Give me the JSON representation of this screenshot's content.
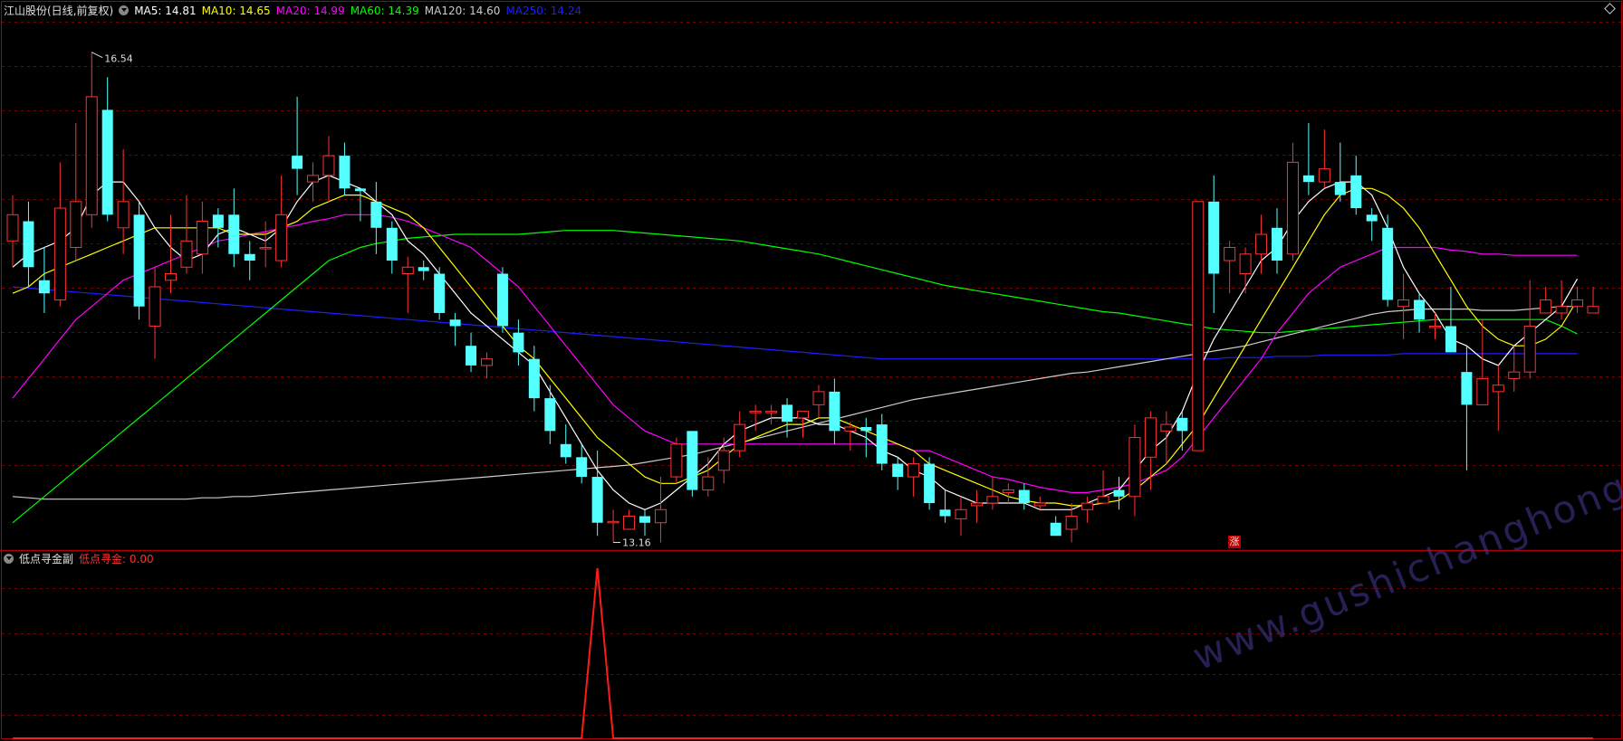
{
  "header": {
    "title": "江山股份(日线,前复权)",
    "ma": [
      {
        "label": "MA5: 14.81",
        "color": "#ffffff"
      },
      {
        "label": "MA10: 14.65",
        "color": "#ffff00"
      },
      {
        "label": "MA20: 14.99",
        "color": "#ff00ff"
      },
      {
        "label": "MA60: 14.39",
        "color": "#00ff00"
      },
      {
        "label": "MA120: 14.60",
        "color": "#cccccc"
      },
      {
        "label": "MA250: 14.24",
        "color": "#1e1eff"
      }
    ]
  },
  "sub_header": {
    "title": "低点寻金副",
    "indicator": "低点寻金: 0.00",
    "indicator_color": "#ff3030"
  },
  "annotations": {
    "high": "16.54",
    "low": "13.16",
    "signal_badge": "涨"
  },
  "watermark": "www.gushichanghong.com",
  "colors": {
    "up": "#ff3232",
    "down": "#54ffff",
    "grid": "#7a0000",
    "frame": "#b00000"
  },
  "chart_data": [
    {
      "type": "candlestick",
      "title": "江山股份(日线,前复权)",
      "ylim": [
        12.9,
        16.8
      ],
      "candles": [
        [
          15.1,
          15.3,
          15.45,
          14.9
        ],
        [
          15.25,
          14.9,
          15.4,
          14.75
        ],
        [
          14.8,
          14.7,
          15.05,
          14.55
        ],
        [
          14.65,
          15.35,
          15.7,
          14.6
        ],
        [
          15.05,
          15.4,
          16.0,
          14.95
        ],
        [
          15.3,
          16.2,
          16.54,
          15.2
        ],
        [
          16.1,
          15.3,
          16.35,
          15.25
        ],
        [
          15.2,
          15.4,
          15.8,
          15.0
        ],
        [
          15.3,
          14.6,
          15.4,
          14.5
        ],
        [
          14.45,
          14.75,
          14.9,
          14.2
        ],
        [
          14.8,
          14.85,
          15.3,
          14.7
        ],
        [
          14.9,
          15.1,
          15.45,
          14.85
        ],
        [
          15.0,
          15.25,
          15.4,
          14.85
        ],
        [
          15.3,
          15.2,
          15.35,
          15.05
        ],
        [
          15.3,
          15.0,
          15.5,
          14.9
        ],
        [
          15.0,
          14.95,
          15.1,
          14.8
        ],
        [
          15.05,
          15.05,
          15.25,
          14.9
        ],
        [
          14.95,
          15.3,
          15.6,
          14.9
        ],
        [
          15.75,
          15.65,
          16.2,
          15.45
        ],
        [
          15.55,
          15.6,
          15.7,
          15.4
        ],
        [
          15.6,
          15.75,
          15.9,
          15.4
        ],
        [
          15.75,
          15.5,
          15.85,
          15.45
        ],
        [
          15.5,
          15.48,
          15.5,
          15.25
        ],
        [
          15.4,
          15.2,
          15.55,
          15.0
        ],
        [
          15.2,
          14.95,
          15.25,
          14.85
        ],
        [
          14.85,
          14.9,
          14.98,
          14.55
        ],
        [
          14.9,
          14.87,
          14.95,
          14.8
        ],
        [
          14.85,
          14.55,
          14.9,
          14.5
        ],
        [
          14.5,
          14.45,
          14.55,
          14.3
        ],
        [
          14.3,
          14.15,
          14.4,
          14.1
        ],
        [
          14.15,
          14.2,
          14.25,
          14.05
        ],
        [
          14.85,
          14.45,
          14.9,
          14.4
        ],
        [
          14.4,
          14.25,
          14.5,
          14.15
        ],
        [
          14.2,
          13.9,
          14.3,
          13.8
        ],
        [
          13.9,
          13.65,
          14.0,
          13.55
        ],
        [
          13.55,
          13.45,
          13.7,
          13.4
        ],
        [
          13.45,
          13.3,
          13.55,
          13.25
        ],
        [
          13.3,
          12.95,
          13.5,
          12.85
        ],
        [
          12.95,
          12.96,
          13.05,
          12.8
        ],
        [
          12.9,
          13.0,
          13.05,
          12.9
        ],
        [
          13.0,
          12.95,
          13.05,
          12.85
        ],
        [
          12.95,
          13.05,
          13.3,
          12.8
        ],
        [
          13.3,
          13.55,
          13.6,
          13.25
        ],
        [
          13.65,
          13.2,
          13.65,
          13.15
        ],
        [
          13.2,
          13.3,
          13.45,
          13.15
        ],
        [
          13.35,
          13.5,
          13.6,
          13.25
        ],
        [
          13.5,
          13.7,
          13.8,
          13.45
        ],
        [
          13.8,
          13.8,
          13.85,
          13.65
        ],
        [
          13.8,
          13.8,
          13.85,
          13.7
        ],
        [
          13.85,
          13.72,
          13.9,
          13.6
        ],
        [
          13.75,
          13.8,
          13.8,
          13.6
        ],
        [
          13.85,
          13.95,
          14.0,
          13.75
        ],
        [
          13.95,
          13.65,
          14.05,
          13.55
        ],
        [
          13.65,
          13.68,
          13.72,
          13.5
        ],
        [
          13.68,
          13.65,
          13.75,
          13.45
        ],
        [
          13.7,
          13.4,
          13.78,
          13.35
        ],
        [
          13.4,
          13.3,
          13.45,
          13.2
        ],
        [
          13.3,
          13.4,
          13.45,
          13.15
        ],
        [
          13.4,
          13.1,
          13.45,
          13.05
        ],
        [
          13.05,
          13.0,
          13.2,
          12.95
        ],
        [
          12.98,
          13.05,
          13.15,
          12.85
        ],
        [
          13.08,
          13.1,
          13.2,
          12.95
        ],
        [
          13.1,
          13.15,
          13.3,
          13.05
        ],
        [
          13.18,
          13.2,
          13.25,
          13.1
        ],
        [
          13.2,
          13.1,
          13.25,
          13.05
        ],
        [
          13.08,
          13.1,
          13.15,
          13.05
        ],
        [
          12.95,
          12.85,
          13.0,
          12.85
        ],
        [
          12.9,
          13.0,
          13.1,
          12.8
        ],
        [
          13.05,
          13.1,
          13.15,
          12.95
        ],
        [
          13.1,
          13.15,
          13.35,
          13.1
        ],
        [
          13.2,
          13.15,
          13.3,
          13.05
        ],
        [
          13.15,
          13.6,
          13.7,
          13.0
        ],
        [
          13.45,
          13.75,
          13.8,
          13.2
        ],
        [
          13.65,
          13.7,
          13.8,
          13.4
        ],
        [
          13.75,
          13.65,
          13.8,
          13.5
        ],
        [
          13.5,
          15.4,
          15.4,
          13.5
        ],
        [
          15.4,
          14.85,
          15.6,
          14.55
        ],
        [
          14.95,
          15.05,
          15.1,
          14.7
        ],
        [
          14.85,
          15.0,
          15.05,
          14.7
        ],
        [
          15.0,
          15.15,
          15.3,
          14.85
        ],
        [
          15.2,
          14.95,
          15.35,
          14.85
        ],
        [
          15.0,
          15.7,
          15.85,
          14.95
        ],
        [
          15.6,
          15.55,
          16.0,
          15.45
        ],
        [
          15.55,
          15.65,
          15.95,
          15.5
        ],
        [
          15.55,
          15.45,
          15.85,
          15.4
        ],
        [
          15.6,
          15.35,
          15.75,
          15.3
        ],
        [
          15.3,
          15.25,
          15.35,
          15.1
        ],
        [
          15.2,
          14.65,
          15.3,
          14.6
        ],
        [
          14.6,
          14.65,
          14.85,
          14.35
        ],
        [
          14.65,
          14.5,
          14.7,
          14.4
        ],
        [
          14.45,
          14.45,
          14.55,
          14.35
        ],
        [
          14.45,
          14.25,
          14.75,
          14.25
        ],
        [
          14.1,
          13.85,
          14.3,
          13.35
        ],
        [
          13.85,
          14.05,
          14.5,
          13.85
        ],
        [
          13.95,
          14.0,
          14.15,
          13.65
        ],
        [
          14.05,
          14.1,
          14.3,
          13.95
        ],
        [
          14.1,
          14.45,
          14.8,
          14.05
        ],
        [
          14.55,
          14.65,
          14.75,
          14.55
        ],
        [
          14.55,
          14.6,
          14.8,
          14.5
        ],
        [
          14.6,
          14.65,
          14.75,
          14.55
        ],
        [
          14.55,
          14.6,
          14.75,
          14.55
        ]
      ],
      "ma5": [
        14.9,
        15.0,
        15.05,
        15.1,
        15.2,
        15.45,
        15.55,
        15.55,
        15.4,
        15.2,
        15.05,
        14.95,
        15.0,
        15.15,
        15.2,
        15.15,
        15.1,
        15.2,
        15.4,
        15.55,
        15.6,
        15.55,
        15.5,
        15.4,
        15.3,
        15.1,
        15.0,
        14.85,
        14.7,
        14.55,
        14.45,
        14.35,
        14.25,
        14.15,
        13.95,
        13.75,
        13.55,
        13.35,
        13.2,
        13.1,
        13.05,
        13.1,
        13.2,
        13.3,
        13.4,
        13.55,
        13.65,
        13.7,
        13.75,
        13.75,
        13.75,
        13.7,
        13.7,
        13.65,
        13.6,
        13.5,
        13.45,
        13.35,
        13.3,
        13.2,
        13.15,
        13.1,
        13.1,
        13.1,
        13.1,
        13.05,
        13.05,
        13.05,
        13.1,
        13.15,
        13.2,
        13.35,
        13.5,
        13.6,
        13.8,
        14.1,
        14.35,
        14.55,
        14.75,
        14.95,
        15.05,
        15.25,
        15.4,
        15.5,
        15.55,
        15.55,
        15.45,
        15.2,
        14.9,
        14.7,
        14.55,
        14.35,
        14.3,
        14.2,
        14.15,
        14.3,
        14.4,
        14.5,
        14.6,
        14.81
      ],
      "ma10": [
        14.7,
        14.75,
        14.85,
        14.9,
        14.95,
        15.0,
        15.05,
        15.1,
        15.15,
        15.2,
        15.2,
        15.2,
        15.2,
        15.2,
        15.15,
        15.15,
        15.15,
        15.2,
        15.25,
        15.35,
        15.4,
        15.45,
        15.45,
        15.4,
        15.35,
        15.3,
        15.2,
        15.05,
        14.9,
        14.75,
        14.6,
        14.45,
        14.3,
        14.2,
        14.05,
        13.9,
        13.75,
        13.6,
        13.5,
        13.4,
        13.3,
        13.25,
        13.25,
        13.3,
        13.35,
        13.45,
        13.55,
        13.6,
        13.65,
        13.7,
        13.7,
        13.75,
        13.75,
        13.7,
        13.65,
        13.6,
        13.55,
        13.5,
        13.4,
        13.35,
        13.3,
        13.25,
        13.2,
        13.15,
        13.12,
        13.1,
        13.1,
        13.08,
        13.08,
        13.1,
        13.12,
        13.2,
        13.3,
        13.4,
        13.55,
        13.7,
        13.9,
        14.1,
        14.3,
        14.5,
        14.7,
        14.9,
        15.1,
        15.3,
        15.45,
        15.5,
        15.5,
        15.45,
        15.35,
        15.2,
        15.0,
        14.8,
        14.6,
        14.45,
        14.35,
        14.3,
        14.3,
        14.35,
        14.45,
        14.65
      ],
      "ma20": [
        13.9,
        14.05,
        14.2,
        14.35,
        14.5,
        14.6,
        14.7,
        14.8,
        14.85,
        14.9,
        14.95,
        15.0,
        15.05,
        15.1,
        15.12,
        15.15,
        15.17,
        15.2,
        15.22,
        15.25,
        15.27,
        15.3,
        15.3,
        15.3,
        15.28,
        15.25,
        15.2,
        15.15,
        15.1,
        15.05,
        14.95,
        14.85,
        14.75,
        14.6,
        14.45,
        14.3,
        14.15,
        14.0,
        13.85,
        13.75,
        13.65,
        13.6,
        13.55,
        13.55,
        13.55,
        13.55,
        13.55,
        13.55,
        13.55,
        13.55,
        13.55,
        13.55,
        13.55,
        13.55,
        13.55,
        13.55,
        13.55,
        13.5,
        13.5,
        13.45,
        13.4,
        13.35,
        13.3,
        13.28,
        13.25,
        13.22,
        13.2,
        13.18,
        13.18,
        13.2,
        13.22,
        13.25,
        13.3,
        13.35,
        13.45,
        13.6,
        13.75,
        13.9,
        14.05,
        14.2,
        14.4,
        14.55,
        14.7,
        14.8,
        14.9,
        14.95,
        15.0,
        15.05,
        15.05,
        15.05,
        15.05,
        15.03,
        15.02,
        15.0,
        15.0,
        14.99,
        14.99,
        14.99,
        14.99,
        14.99
      ],
      "ma60": [
        12.95,
        13.05,
        13.15,
        13.25,
        13.35,
        13.45,
        13.55,
        13.65,
        13.75,
        13.85,
        13.95,
        14.05,
        14.15,
        14.25,
        14.35,
        14.45,
        14.55,
        14.65,
        14.75,
        14.85,
        14.95,
        15.0,
        15.05,
        15.08,
        15.1,
        15.12,
        15.13,
        15.14,
        15.15,
        15.15,
        15.15,
        15.15,
        15.15,
        15.16,
        15.17,
        15.18,
        15.18,
        15.18,
        15.18,
        15.17,
        15.16,
        15.15,
        15.14,
        15.13,
        15.12,
        15.11,
        15.1,
        15.08,
        15.06,
        15.04,
        15.02,
        15.0,
        14.97,
        14.94,
        14.91,
        14.88,
        14.85,
        14.82,
        14.79,
        14.76,
        14.74,
        14.72,
        14.7,
        14.68,
        14.66,
        14.64,
        14.62,
        14.6,
        14.58,
        14.56,
        14.55,
        14.53,
        14.51,
        14.49,
        14.47,
        14.45,
        14.43,
        14.42,
        14.41,
        14.4,
        14.4,
        14.41,
        14.42,
        14.43,
        14.44,
        14.45,
        14.46,
        14.47,
        14.48,
        14.49,
        14.5,
        14.5,
        14.5,
        14.5,
        14.5,
        14.5,
        14.5,
        14.5,
        14.45,
        14.39
      ],
      "ma120": [
        13.15,
        13.14,
        13.13,
        13.13,
        13.13,
        13.13,
        13.13,
        13.13,
        13.13,
        13.13,
        13.13,
        13.13,
        13.14,
        13.14,
        13.15,
        13.15,
        13.16,
        13.17,
        13.18,
        13.19,
        13.2,
        13.21,
        13.22,
        13.23,
        13.24,
        13.25,
        13.26,
        13.27,
        13.28,
        13.29,
        13.3,
        13.31,
        13.32,
        13.33,
        13.34,
        13.35,
        13.36,
        13.37,
        13.38,
        13.39,
        13.41,
        13.43,
        13.45,
        13.47,
        13.5,
        13.53,
        13.56,
        13.59,
        13.62,
        13.65,
        13.68,
        13.71,
        13.74,
        13.77,
        13.8,
        13.83,
        13.86,
        13.89,
        13.91,
        13.93,
        13.95,
        13.97,
        13.99,
        14.01,
        14.03,
        14.05,
        14.07,
        14.09,
        14.1,
        14.12,
        14.14,
        14.16,
        14.18,
        14.2,
        14.22,
        14.24,
        14.26,
        14.28,
        14.3,
        14.33,
        14.36,
        14.39,
        14.42,
        14.45,
        14.48,
        14.51,
        14.54,
        14.56,
        14.57,
        14.58,
        14.58,
        14.58,
        14.58,
        14.57,
        14.57,
        14.57,
        14.58,
        14.59,
        14.6,
        14.6
      ],
      "ma250": [
        14.75,
        14.74,
        14.73,
        14.72,
        14.71,
        14.7,
        14.69,
        14.68,
        14.67,
        14.66,
        14.65,
        14.64,
        14.63,
        14.62,
        14.61,
        14.6,
        14.59,
        14.58,
        14.57,
        14.56,
        14.55,
        14.54,
        14.53,
        14.52,
        14.51,
        14.5,
        14.49,
        14.48,
        14.47,
        14.46,
        14.45,
        14.44,
        14.43,
        14.42,
        14.41,
        14.4,
        14.39,
        14.38,
        14.37,
        14.36,
        14.35,
        14.34,
        14.33,
        14.32,
        14.31,
        14.3,
        14.29,
        14.28,
        14.27,
        14.26,
        14.25,
        14.24,
        14.23,
        14.22,
        14.21,
        14.2,
        14.2,
        14.2,
        14.2,
        14.2,
        14.2,
        14.2,
        14.2,
        14.2,
        14.2,
        14.2,
        14.2,
        14.2,
        14.2,
        14.2,
        14.2,
        14.2,
        14.2,
        14.2,
        14.2,
        14.2,
        14.2,
        14.21,
        14.21,
        14.21,
        14.22,
        14.22,
        14.22,
        14.23,
        14.23,
        14.23,
        14.23,
        14.23,
        14.24,
        14.24,
        14.24,
        14.24,
        14.24,
        14.24,
        14.24,
        14.24,
        14.24,
        14.24,
        14.24,
        14.24
      ]
    },
    {
      "type": "line",
      "title": "低点寻金副",
      "series": [
        {
          "name": "低点寻金",
          "spike_index": 37,
          "spike_value": 1,
          "values": "0 except spike"
        }
      ],
      "ylim": [
        0,
        1
      ]
    }
  ]
}
